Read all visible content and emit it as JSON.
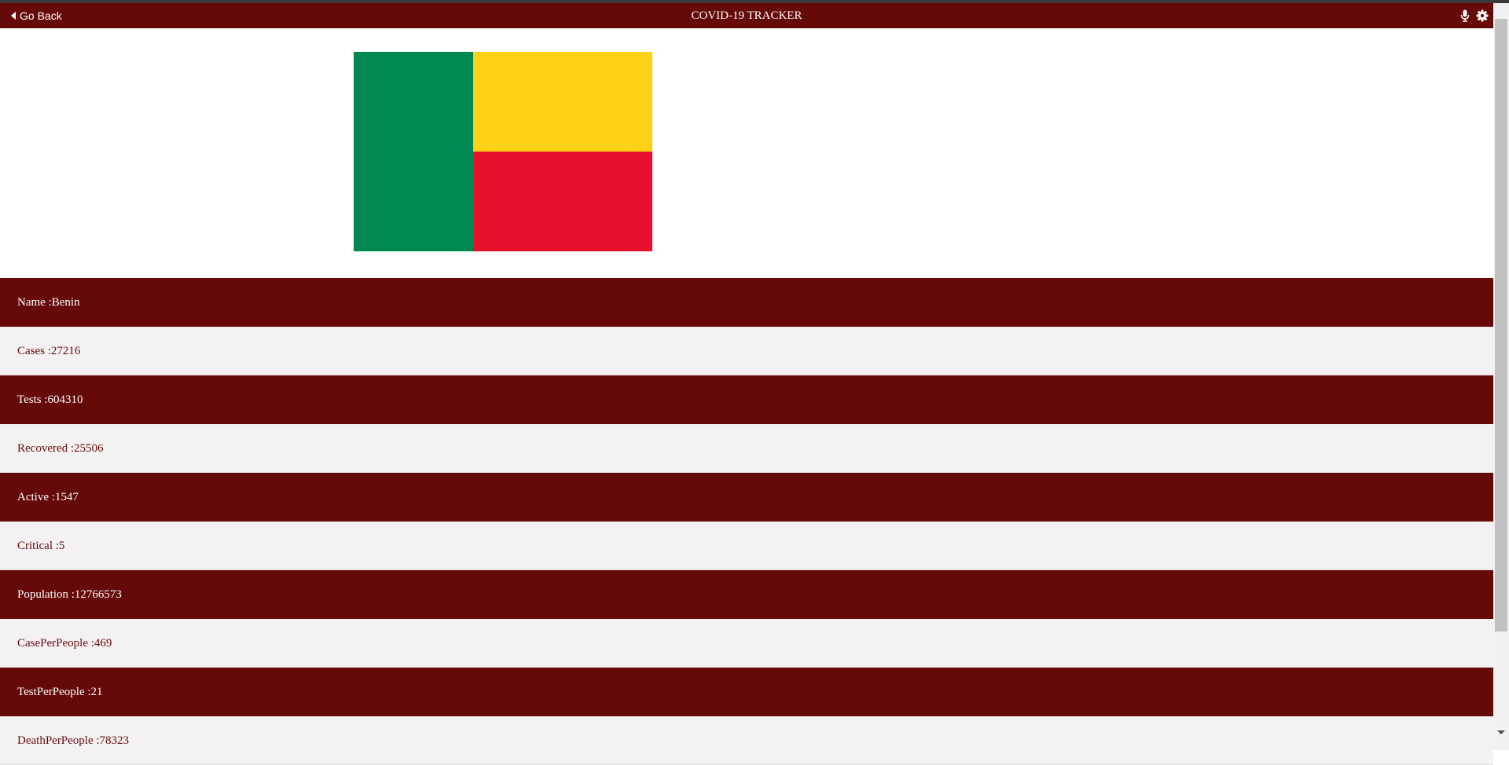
{
  "header": {
    "back_label": "Go Back",
    "title": "COVID-19 TRACKER",
    "icons": [
      "microphone-icon",
      "gear-icon"
    ]
  },
  "flag": {
    "country": "Benin",
    "colors": {
      "green": "#018751",
      "yellow": "#fcd116",
      "red": "#e8112d"
    }
  },
  "theme": {
    "primary": "#650909",
    "light_row": "#f3f1f2"
  },
  "stats": [
    {
      "text": "Name :Benin"
    },
    {
      "text": "Cases :27216"
    },
    {
      "text": "Tests :604310"
    },
    {
      "text": "Recovered :25506"
    },
    {
      "text": "Active :1547"
    },
    {
      "text": "Critical :5"
    },
    {
      "text": "Population :12766573"
    },
    {
      "text": "CasePerPeople :469"
    },
    {
      "text": "TestPerPeople :21"
    },
    {
      "text": "DeathPerPeople :78323"
    }
  ]
}
